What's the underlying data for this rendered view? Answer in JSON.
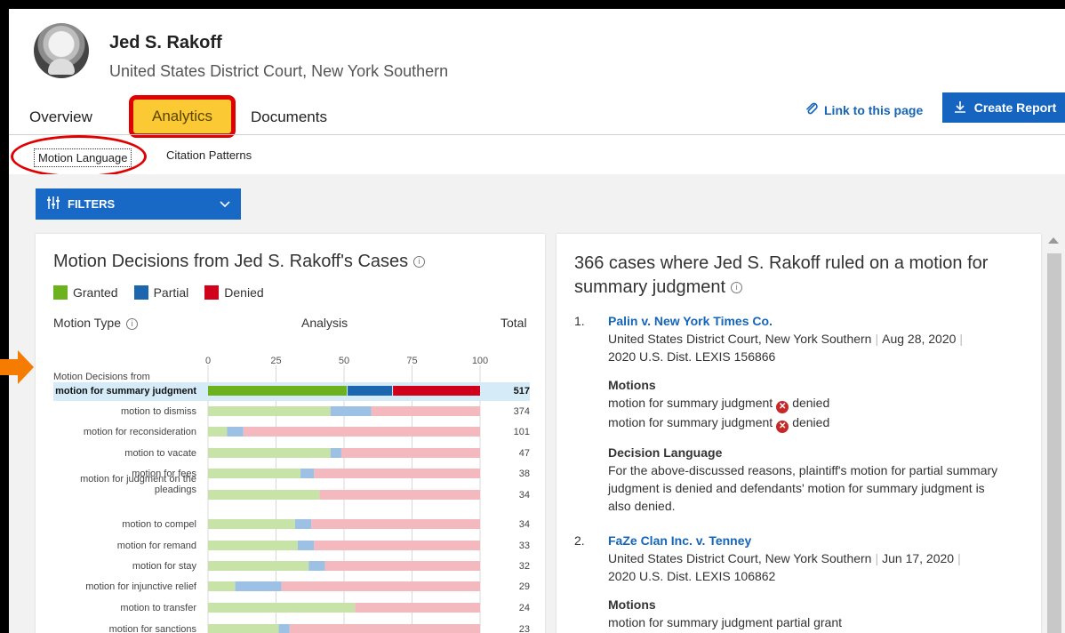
{
  "judge": {
    "name": "Jed S. Rakoff",
    "court": "United States District Court, New York Southern"
  },
  "tabs": {
    "overview": "Overview",
    "analytics": "Analytics",
    "documents": "Documents"
  },
  "actions": {
    "link": "Link to this page",
    "create_report": "Create Report"
  },
  "subtabs": {
    "motion_language": "Motion Language",
    "citation_patterns": "Citation Patterns"
  },
  "filters_label": "FILTERS",
  "chart_data": {
    "type": "bar",
    "title": "Motion Decisions from Jed S. Rakoff's Cases",
    "legend": [
      "Granted",
      "Partial",
      "Denied"
    ],
    "colors": {
      "Granted": "#6cb21e",
      "Partial": "#1c66b0",
      "Denied": "#d0021b"
    },
    "headers": {
      "type": "Motion Type",
      "analysis": "Analysis",
      "total": "Total"
    },
    "group_label": "Motion Decisions from",
    "ticks": [
      0,
      25,
      50,
      75,
      100
    ],
    "xlim": [
      0,
      100
    ],
    "stacked": true,
    "highlight": "motion for summary judgment",
    "rows": [
      {
        "label": "motion for summary judgment",
        "granted": 51,
        "partial": 17,
        "denied": 32,
        "total": "517"
      },
      {
        "label": "motion to dismiss",
        "granted": 45,
        "partial": 15,
        "denied": 40,
        "total": "374"
      },
      {
        "label": "motion for reconsideration",
        "granted": 7,
        "partial": 6,
        "denied": 87,
        "total": "101"
      },
      {
        "label": "motion to vacate",
        "granted": 45,
        "partial": 4,
        "denied": 51,
        "total": "47"
      },
      {
        "label": "motion for fees",
        "granted": 34,
        "partial": 5,
        "denied": 61,
        "total": "38"
      },
      {
        "label": "motion for judgment on the pleadings",
        "label_lines": [
          "motion for judgment on the",
          "pleadings"
        ],
        "granted": 41,
        "partial": 0,
        "denied": 59,
        "total": "34"
      },
      {
        "label": "motion to compel",
        "granted": 32,
        "partial": 6,
        "denied": 62,
        "total": "34"
      },
      {
        "label": "motion for remand",
        "granted": 33,
        "partial": 6,
        "denied": 61,
        "total": "33"
      },
      {
        "label": "motion for stay",
        "granted": 37,
        "partial": 6,
        "denied": 57,
        "total": "32"
      },
      {
        "label": "motion for injunctive relief",
        "granted": 10,
        "partial": 17,
        "denied": 73,
        "total": "29"
      },
      {
        "label": "motion to transfer",
        "granted": 54,
        "partial": 0,
        "denied": 46,
        "total": "24"
      },
      {
        "label": "motion for sanctions",
        "granted": 26,
        "partial": 4,
        "denied": 70,
        "total": "23"
      }
    ]
  },
  "results": {
    "title": "366 cases where Jed S. Rakoff ruled on a motion for summary judgment",
    "cases": [
      {
        "num": "1.",
        "name": "Palin v. New York Times Co.",
        "court": "United States District Court, New York Southern",
        "date": "Aug 28, 2020",
        "cite": "2020 U.S. Dist. LEXIS 156866",
        "motions_label": "Motions",
        "motions": [
          {
            "text": "motion for summary judgment",
            "status": "denied"
          },
          {
            "text": "motion for summary judgment",
            "status": "denied"
          }
        ],
        "decision_label": "Decision Language",
        "decision": "For the above-discussed reasons, plaintiff's motion for partial summary judgment is denied and defendants' motion for summary judgment is also denied."
      },
      {
        "num": "2.",
        "name": "FaZe Clan Inc. v. Tenney",
        "court": "United States District Court, New York Southern",
        "date": "Jun 17, 2020",
        "cite": "2020 U.S. Dist. LEXIS 106862",
        "motions_label": "Motions",
        "motion_text": "motion for summary judgment",
        "motion_status": "partial grant"
      }
    ]
  },
  "icons": {
    "link": "paperclip-icon",
    "download": "download-icon",
    "filter": "sliders-icon",
    "info": "info-icon",
    "denied": "x-circle-icon"
  },
  "annotation_colors": {
    "highlight_box": "#e00000",
    "arrow": "#f57c00"
  }
}
